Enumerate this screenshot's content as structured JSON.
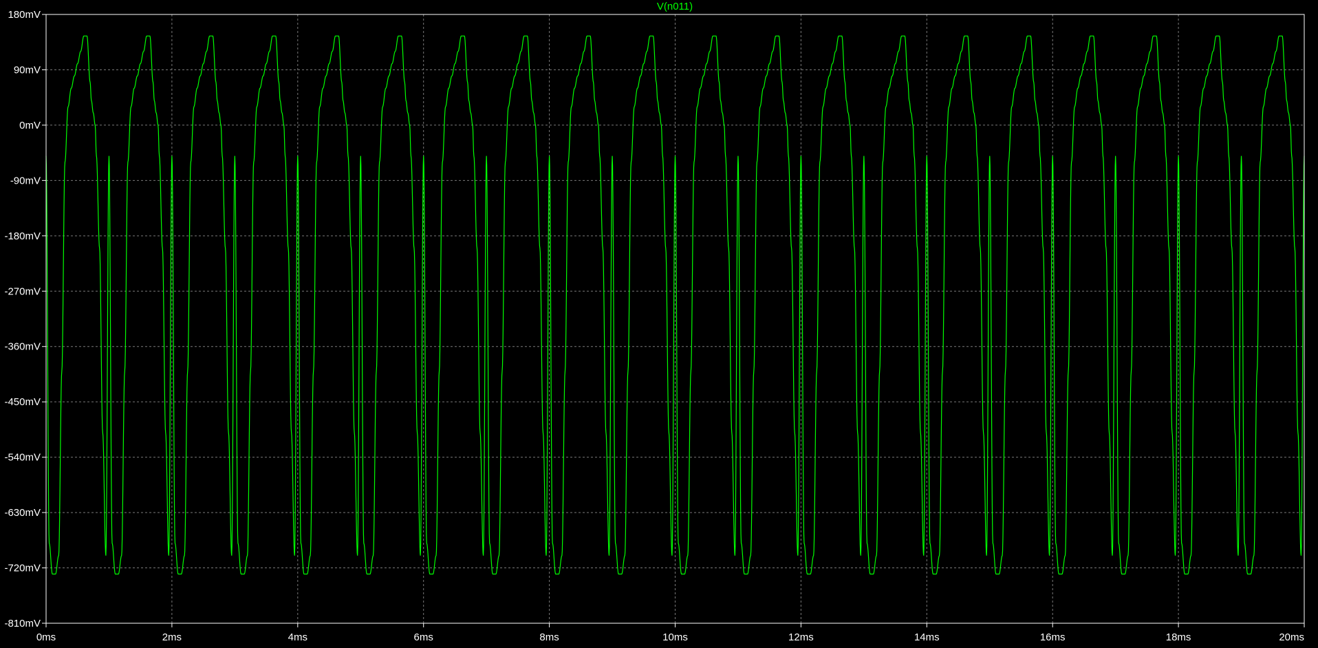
{
  "chart_data": {
    "type": "line",
    "title": "V(n011)",
    "xlabel": "",
    "ylabel": "",
    "x_unit": "ms",
    "y_unit": "mV",
    "xlim": [
      0,
      20
    ],
    "ylim": [
      -810,
      180
    ],
    "x_ticks": [
      0,
      2,
      4,
      6,
      8,
      10,
      12,
      14,
      16,
      18,
      20
    ],
    "x_tick_labels": [
      "0ms",
      "2ms",
      "4ms",
      "6ms",
      "8ms",
      "10ms",
      "12ms",
      "14ms",
      "16ms",
      "18ms",
      "20ms"
    ],
    "y_ticks": [
      180,
      90,
      0,
      -90,
      -180,
      -270,
      -360,
      -450,
      -540,
      -630,
      -720,
      -810
    ],
    "y_tick_labels": [
      "180mV",
      "90mV",
      "0mV",
      "-90mV",
      "-180mV",
      "-270mV",
      "-360mV",
      "-450mV",
      "-540mV",
      "-630mV",
      "-720mV",
      "-810mV"
    ],
    "grid": true,
    "legend": "none",
    "series": [
      {
        "period_ms": 1.0,
        "x": [
          0.0,
          0.05,
          0.1,
          0.15,
          0.2,
          0.25,
          0.3,
          0.35,
          0.4,
          0.45,
          0.5,
          0.55,
          0.6,
          0.65,
          0.7,
          0.72,
          0.75,
          0.78,
          0.8,
          0.85,
          0.9,
          0.95,
          1.0
        ],
        "y": [
          -50,
          -680,
          -730,
          -730,
          -700,
          -400,
          -60,
          30,
          60,
          80,
          100,
          120,
          145,
          145,
          70,
          40,
          20,
          0,
          -50,
          -200,
          -500,
          -700,
          -50
        ]
      }
    ],
    "colors": {
      "background": "#000000",
      "axis": "#ffffff",
      "grid": "#7a7a7a",
      "trace": "#00ff00",
      "title": "#00ff00"
    }
  }
}
